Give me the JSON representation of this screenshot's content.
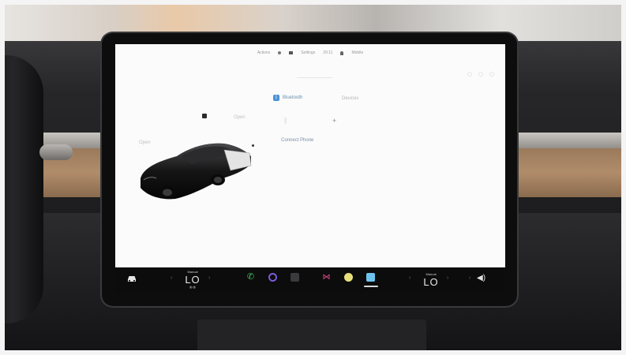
{
  "status_bar": {
    "drive_mode": "P",
    "left_text": "Actions",
    "center_text": "Settings",
    "time": "20:11",
    "profile": "Mobile"
  },
  "car_panel": {
    "open_label": "Open",
    "open_label_2": "Open",
    "trunk_label": "Open"
  },
  "bluetooth": {
    "tab_label": "Bluetooth",
    "devices_label": "Devices",
    "connect_label": "Connect Phone",
    "bt_glyph": "ᛒ",
    "plus_glyph": "+"
  },
  "taskbar": {
    "driver_climate": {
      "label": "Manual",
      "temp": "LO",
      "fan": "❄❄"
    },
    "passenger_climate": {
      "label": "Manual",
      "temp": "LO"
    },
    "left_chevron": "‹",
    "right_chevron": "›",
    "phone_glyph": "✆",
    "tidal_glyph": "⋈",
    "volume_glyph": "◀)"
  },
  "icons": {
    "car": "car-icon",
    "phone": "phone-icon",
    "music": "music-icon",
    "calendar": "calendar-icon",
    "tidal": "tidal-icon",
    "toybox": "toybox-icon",
    "app_launcher": "app-launcher-icon",
    "volume": "volume-icon"
  },
  "colors": {
    "screen_bg": "#fbfbfb",
    "taskbar_bg": "#0c0c0d",
    "bluetooth_accent": "#4a90d9",
    "phone_green": "#46c25a"
  }
}
